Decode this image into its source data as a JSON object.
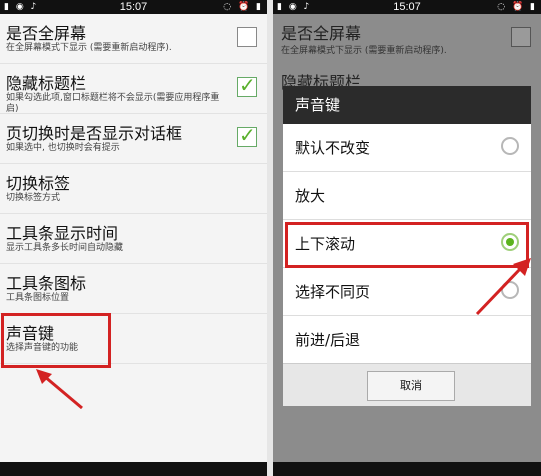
{
  "left": {
    "status": {
      "left_icons": "▮ ◉ ♪",
      "time": "15:07",
      "right_icons": "◌ ⏰ ▮"
    },
    "items": [
      {
        "title": "是否全屏幕",
        "sub": "在全屏幕模式下显示 (需要重新启动程序).",
        "checked": false,
        "show_cb": true
      },
      {
        "title": "隐藏标题栏",
        "sub": "如果勾选此项,窗口标题栏将不会显示(需要应用程序重启)",
        "checked": true,
        "show_cb": true
      },
      {
        "title": "页切换时是否显示对话框",
        "sub": "如果选中, 也切换时会有提示",
        "checked": true,
        "show_cb": true
      },
      {
        "title": "切换标签",
        "sub": "切换标签方式",
        "show_cb": false
      },
      {
        "title": "工具条显示时间",
        "sub": "显示工具条多长时间自动隐藏",
        "show_cb": false
      },
      {
        "title": "工具条图标",
        "sub": "工具条图标位置",
        "show_cb": false
      },
      {
        "title": "声音键",
        "sub": "选择声音键的功能",
        "show_cb": false
      }
    ]
  },
  "right": {
    "status": {
      "left_icons": "▮ ◉ ♪",
      "time": "15:07",
      "right_icons": "◌ ⏰ ▮"
    },
    "bg_items": [
      {
        "title": "是否全屏幕",
        "sub": "在全屏幕模式下显示 (需要重新启动程序)."
      },
      {
        "title": "隐藏标题栏"
      }
    ],
    "dialog": {
      "title": "声音键",
      "options": [
        {
          "label": "默认不改变",
          "selected": false
        },
        {
          "label": "放大",
          "selected": false,
          "no_radio": true
        },
        {
          "label": "上下滚动",
          "selected": true
        },
        {
          "label": "选择不同页",
          "selected": false
        },
        {
          "label": "前进/后退",
          "selected": false,
          "no_radio": true
        }
      ],
      "cancel": "取消"
    }
  },
  "colors": {
    "highlight": "#d32222",
    "check": "#59b02c",
    "radio": "#5cb31e"
  }
}
